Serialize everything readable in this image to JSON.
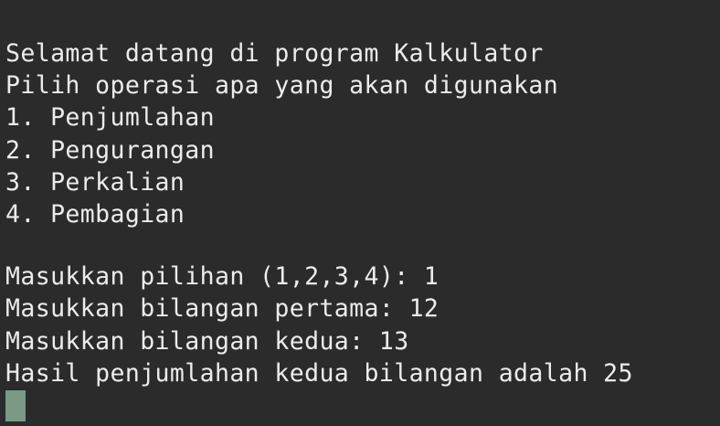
{
  "terminal": {
    "intro": [
      "Selamat datang di program Kalkulator",
      "Pilih operasi apa yang akan digunakan"
    ],
    "menu": [
      "1. Penjumlahan",
      "2. Pengurangan",
      "3. Perkalian",
      "4. Pembagian"
    ],
    "session": [
      "Masukkan pilihan (1,2,3,4): 1",
      "Masukkan bilangan pertama: 12",
      "Masukkan bilangan kedua: 13",
      "Hasil penjumlahan kedua bilangan adalah 25"
    ],
    "colors": {
      "background": "#2b2b2b",
      "text": "#ececec",
      "cursor": "#7a9a86"
    }
  }
}
